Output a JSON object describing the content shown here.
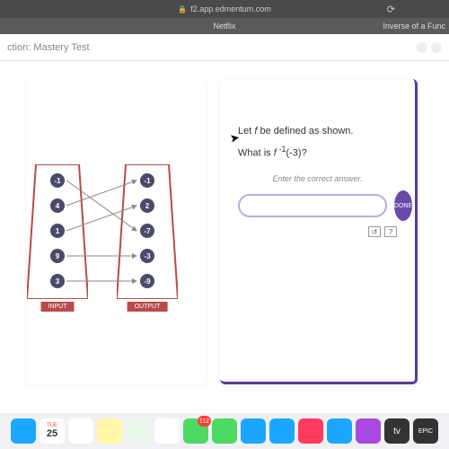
{
  "browser": {
    "url": "f2.app.edmentum.com",
    "tab_center": "Netflix",
    "tab_right": "Inverse of a Func"
  },
  "header": {
    "title": "ction: Mastery Test"
  },
  "mapping": {
    "input_label": "INPUT",
    "output_label": "OUTPUT",
    "input_nodes": [
      "-1",
      "4",
      "1",
      "9",
      "3"
    ],
    "output_nodes": [
      "-1",
      "2",
      "-7",
      "-3",
      "-9"
    ]
  },
  "question": {
    "line1": "Let f be defined as shown.",
    "line2": "What is f⁻¹(-3)?",
    "instruction": "Enter the correct answer.",
    "done_label": "DONE",
    "answer_value": "",
    "answer_placeholder": ""
  },
  "helpers": {
    "undo": "↺",
    "help": "?"
  },
  "dock": {
    "items": [
      {
        "name": "finder",
        "color": "#1ba7ff"
      },
      {
        "name": "calendar",
        "color": "#ffffff",
        "day": "25",
        "weekday": "TUE"
      },
      {
        "name": "reminders",
        "color": "#ffffff"
      },
      {
        "name": "notes",
        "color": "#fff6a8"
      },
      {
        "name": "maps",
        "color": "#e8f6e8"
      },
      {
        "name": "photos",
        "color": "#ffffff"
      },
      {
        "name": "messages",
        "color": "#4cd964",
        "badge": "112"
      },
      {
        "name": "facetime",
        "color": "#4cd964"
      },
      {
        "name": "safari",
        "color": "#1ba7ff"
      },
      {
        "name": "mail",
        "color": "#1ba7ff"
      },
      {
        "name": "news",
        "color": "#ff3b60"
      },
      {
        "name": "appstore",
        "color": "#1ba7ff"
      },
      {
        "name": "podcasts",
        "color": "#a84adf"
      },
      {
        "name": "appletv",
        "color": "#333333",
        "text": "tv"
      },
      {
        "name": "epic",
        "color": "#333333",
        "text": "EPIC"
      }
    ]
  }
}
